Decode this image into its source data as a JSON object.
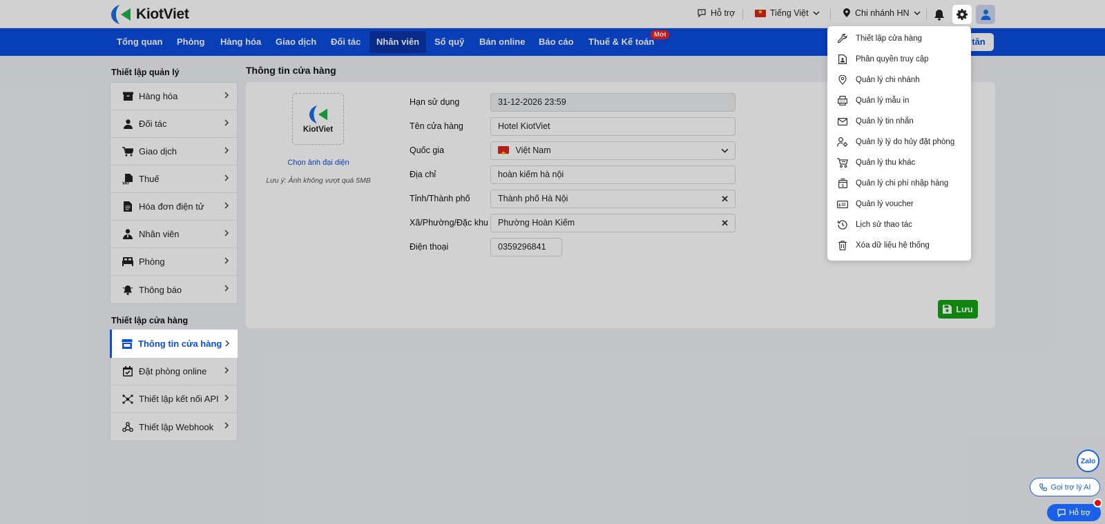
{
  "brand": {
    "name": "KiotViet"
  },
  "header": {
    "support": "Hỗ trợ",
    "language": "Tiếng Việt",
    "branch": "Chi nhánh HN"
  },
  "nav": {
    "items": [
      "Tổng quan",
      "Phòng",
      "Hàng hóa",
      "Giao dịch",
      "Đối tác",
      "Nhân viên",
      "Sổ quỹ",
      "Bán online",
      "Báo cáo",
      "Thuế & Kế toán"
    ],
    "active": "Nhân viên",
    "new_badge": "Mới",
    "right_button": "tân"
  },
  "sidebar": {
    "manage_title": "Thiết lập quản lý",
    "manage_items": [
      "Hàng hóa",
      "Đối tác",
      "Giao dịch",
      "Thuế",
      "Hóa đơn điện tử",
      "Nhân viên",
      "Phòng",
      "Thông báo"
    ],
    "store_title": "Thiết lập cửa hàng",
    "store_items": [
      "Thông tin cửa hàng",
      "Đặt phòng online",
      "Thiết lập kết nối API",
      "Thiết lập Webhook"
    ],
    "active": "Thông tin cửa hàng"
  },
  "main": {
    "title": "Thông tin cửa hàng",
    "logo_text": "KiotViet",
    "choose_image": "Chọn ảnh đại diện",
    "image_note": "Lưu ý: Ảnh không vượt quá 5MB",
    "fields": {
      "expiry_label": "Hạn sử dụng",
      "expiry_value": "31-12-2026 23:59",
      "store_name_label": "Tên cửa hàng",
      "store_name_value": "Hotel KiotViet",
      "country_label": "Quốc gia",
      "country_value": "Việt Nam",
      "address_label": "Địa chỉ",
      "address_value": "hoàn kiếm hà nội",
      "city_label": "Tỉnh/Thành phố",
      "city_value": "Thành phố Hà Nội",
      "ward_label": "Xã/Phường/Đặc khu",
      "ward_value": "Phường Hoàn Kiếm",
      "phone_label": "Điện thoại",
      "phone_value": "0359296841"
    },
    "save": "Lưu"
  },
  "settings_menu": {
    "items": [
      "Thiết lập cửa hàng",
      "Phân quyền truy cập",
      "Quản lý chi nhánh",
      "Quản lý mẫu in",
      "Quản lý tin nhắn",
      "Quản lý lý do hủy đặt phòng",
      "Quản lý thu khác",
      "Quản lý chi phí nhập hàng",
      "Quản lý voucher",
      "Lịch sử thao tác",
      "Xóa dữ liệu hệ thống"
    ],
    "highlighted": "Thiết lập cửa hàng"
  },
  "floating": {
    "zalo": "Zalo",
    "ai": "Gọi trợ lý AI",
    "help": "Hỗ trợ"
  },
  "colors": {
    "primary": "#0a4ee0",
    "nav_active": "#0a35a8",
    "save": "#13a113",
    "badge": "#e22222"
  }
}
